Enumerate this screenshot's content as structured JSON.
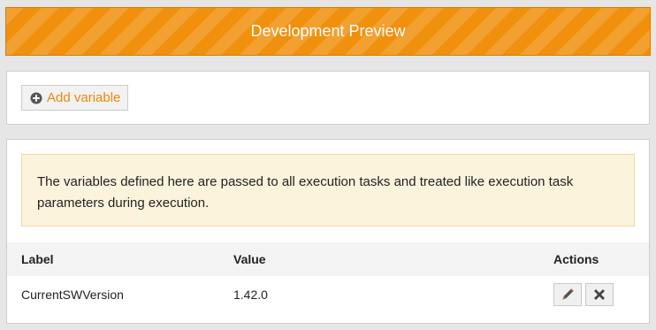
{
  "banner": {
    "title": "Development Preview"
  },
  "toolbar": {
    "add_variable_label": "Add variable"
  },
  "info": {
    "text": "The variables defined here are passed to all execution tasks and treated like execution task parameters during execution."
  },
  "table": {
    "columns": {
      "label": "Label",
      "value": "Value",
      "actions": "Actions"
    },
    "rows": [
      {
        "label": "CurrentSWVersion",
        "value": "1.42.0"
      }
    ]
  },
  "icons": {
    "add": "plus-circle-icon",
    "edit": "pencil-icon",
    "delete": "times-icon"
  },
  "colors": {
    "banner": "#f0900d",
    "accent_text": "#e8890c",
    "info_background": "#fcf3dc"
  }
}
